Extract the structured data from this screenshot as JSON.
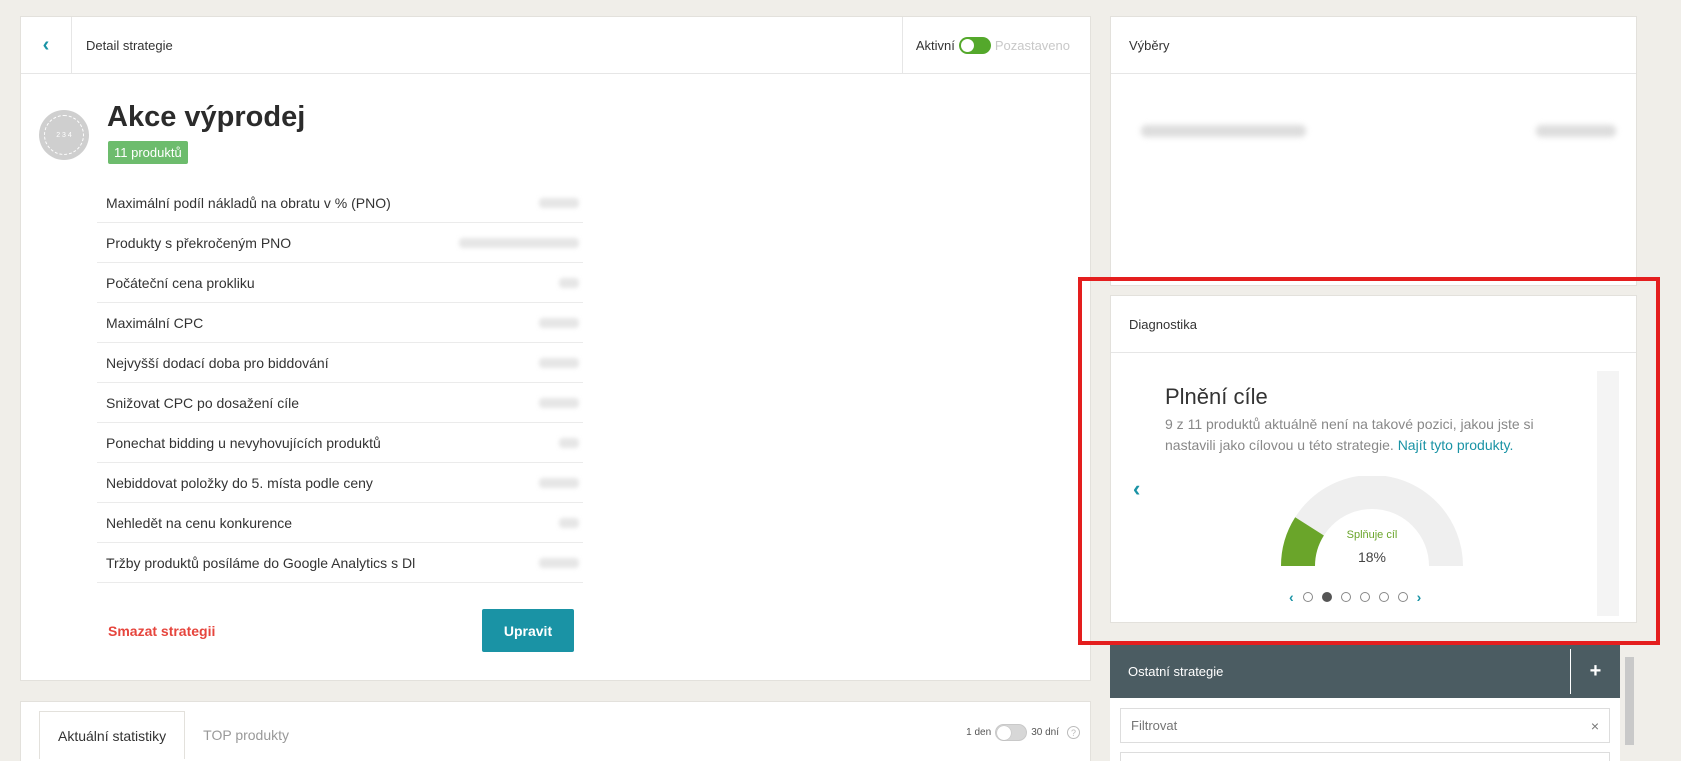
{
  "detail": {
    "header_title": "Detail strategie",
    "status_active": "Aktivní",
    "status_paused": "Pozastaveno",
    "avatar_text": "2 3 4",
    "title": "Akce výprodej",
    "product_count": "11 produktů",
    "params": [
      {
        "label": "Maximální podíl nákladů na obratu v % (PNO)"
      },
      {
        "label": "Produkty s překročeným PNO"
      },
      {
        "label": "Počáteční cena prokliku"
      },
      {
        "label": "Maximální CPC"
      },
      {
        "label": "Nejvyšší dodací doba pro biddování"
      },
      {
        "label": "Snižovat CPC po dosažení cíle"
      },
      {
        "label": "Ponechat bidding u nevyhovujících produktů"
      },
      {
        "label": "Nebiddovat položky do 5. místa podle ceny"
      },
      {
        "label": "Nehledět na cenu konkurence"
      },
      {
        "label": "Tržby produktů posíláme do Google Analytics s Dl"
      }
    ],
    "delete_label": "Smazat strategii",
    "edit_label": "Upravit"
  },
  "stats": {
    "tabs": [
      {
        "label": "Aktuální statistiky"
      },
      {
        "label": "TOP produkty"
      }
    ],
    "period_short": "1 den",
    "period_long": "30 dní",
    "help": "?"
  },
  "selections": {
    "title": "Výběry"
  },
  "diagnostics": {
    "title": "Diagnostika",
    "slide_title": "Plnění cíle",
    "slide_text": "9 z 11 produktů aktuálně není na takové pozici, jakou jste si nastavili jako cílovou u této strategie.",
    "slide_link": "Najít tyto produkty.",
    "gauge_label": "Splňuje cíl",
    "gauge_value_text": "18%",
    "gauge_value": 0.18,
    "active_dot": 1,
    "dot_count": 6,
    "colors": {
      "accent": "#1a93a5",
      "gauge_fill": "#6aa52a",
      "gauge_track": "#efefef"
    }
  },
  "other": {
    "title": "Ostatní strategie",
    "add": "+",
    "filter_placeholder": "Filtrovat",
    "filter_clear": "×"
  }
}
